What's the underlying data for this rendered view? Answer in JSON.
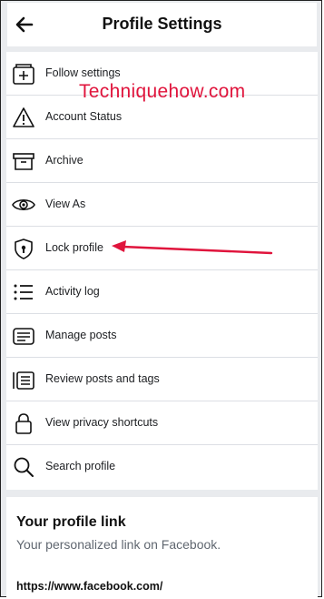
{
  "header": {
    "title": "Profile Settings",
    "back_icon": "arrow-left-icon"
  },
  "watermark": "Techniquehow.com",
  "menu": [
    {
      "label": "Follow settings",
      "icon": "follow-icon"
    },
    {
      "label": "Account Status",
      "icon": "warning-icon"
    },
    {
      "label": "Archive",
      "icon": "archive-icon"
    },
    {
      "label": "View As",
      "icon": "eye-icon"
    },
    {
      "label": "Lock profile",
      "icon": "shield-lock-icon"
    },
    {
      "label": "Activity log",
      "icon": "list-icon"
    },
    {
      "label": "Manage posts",
      "icon": "manage-posts-icon"
    },
    {
      "label": "Review posts and tags",
      "icon": "review-icon"
    },
    {
      "label": "View privacy shortcuts",
      "icon": "lock-icon"
    },
    {
      "label": "Search profile",
      "icon": "search-icon"
    }
  ],
  "profile_link": {
    "title": "Your profile link",
    "subtitle": "Your personalized link on Facebook.",
    "url": "https://www.facebook.com/"
  },
  "colors": {
    "watermark": "#e0143c",
    "arrow": "#e0143c",
    "background": "#e9ebee"
  }
}
